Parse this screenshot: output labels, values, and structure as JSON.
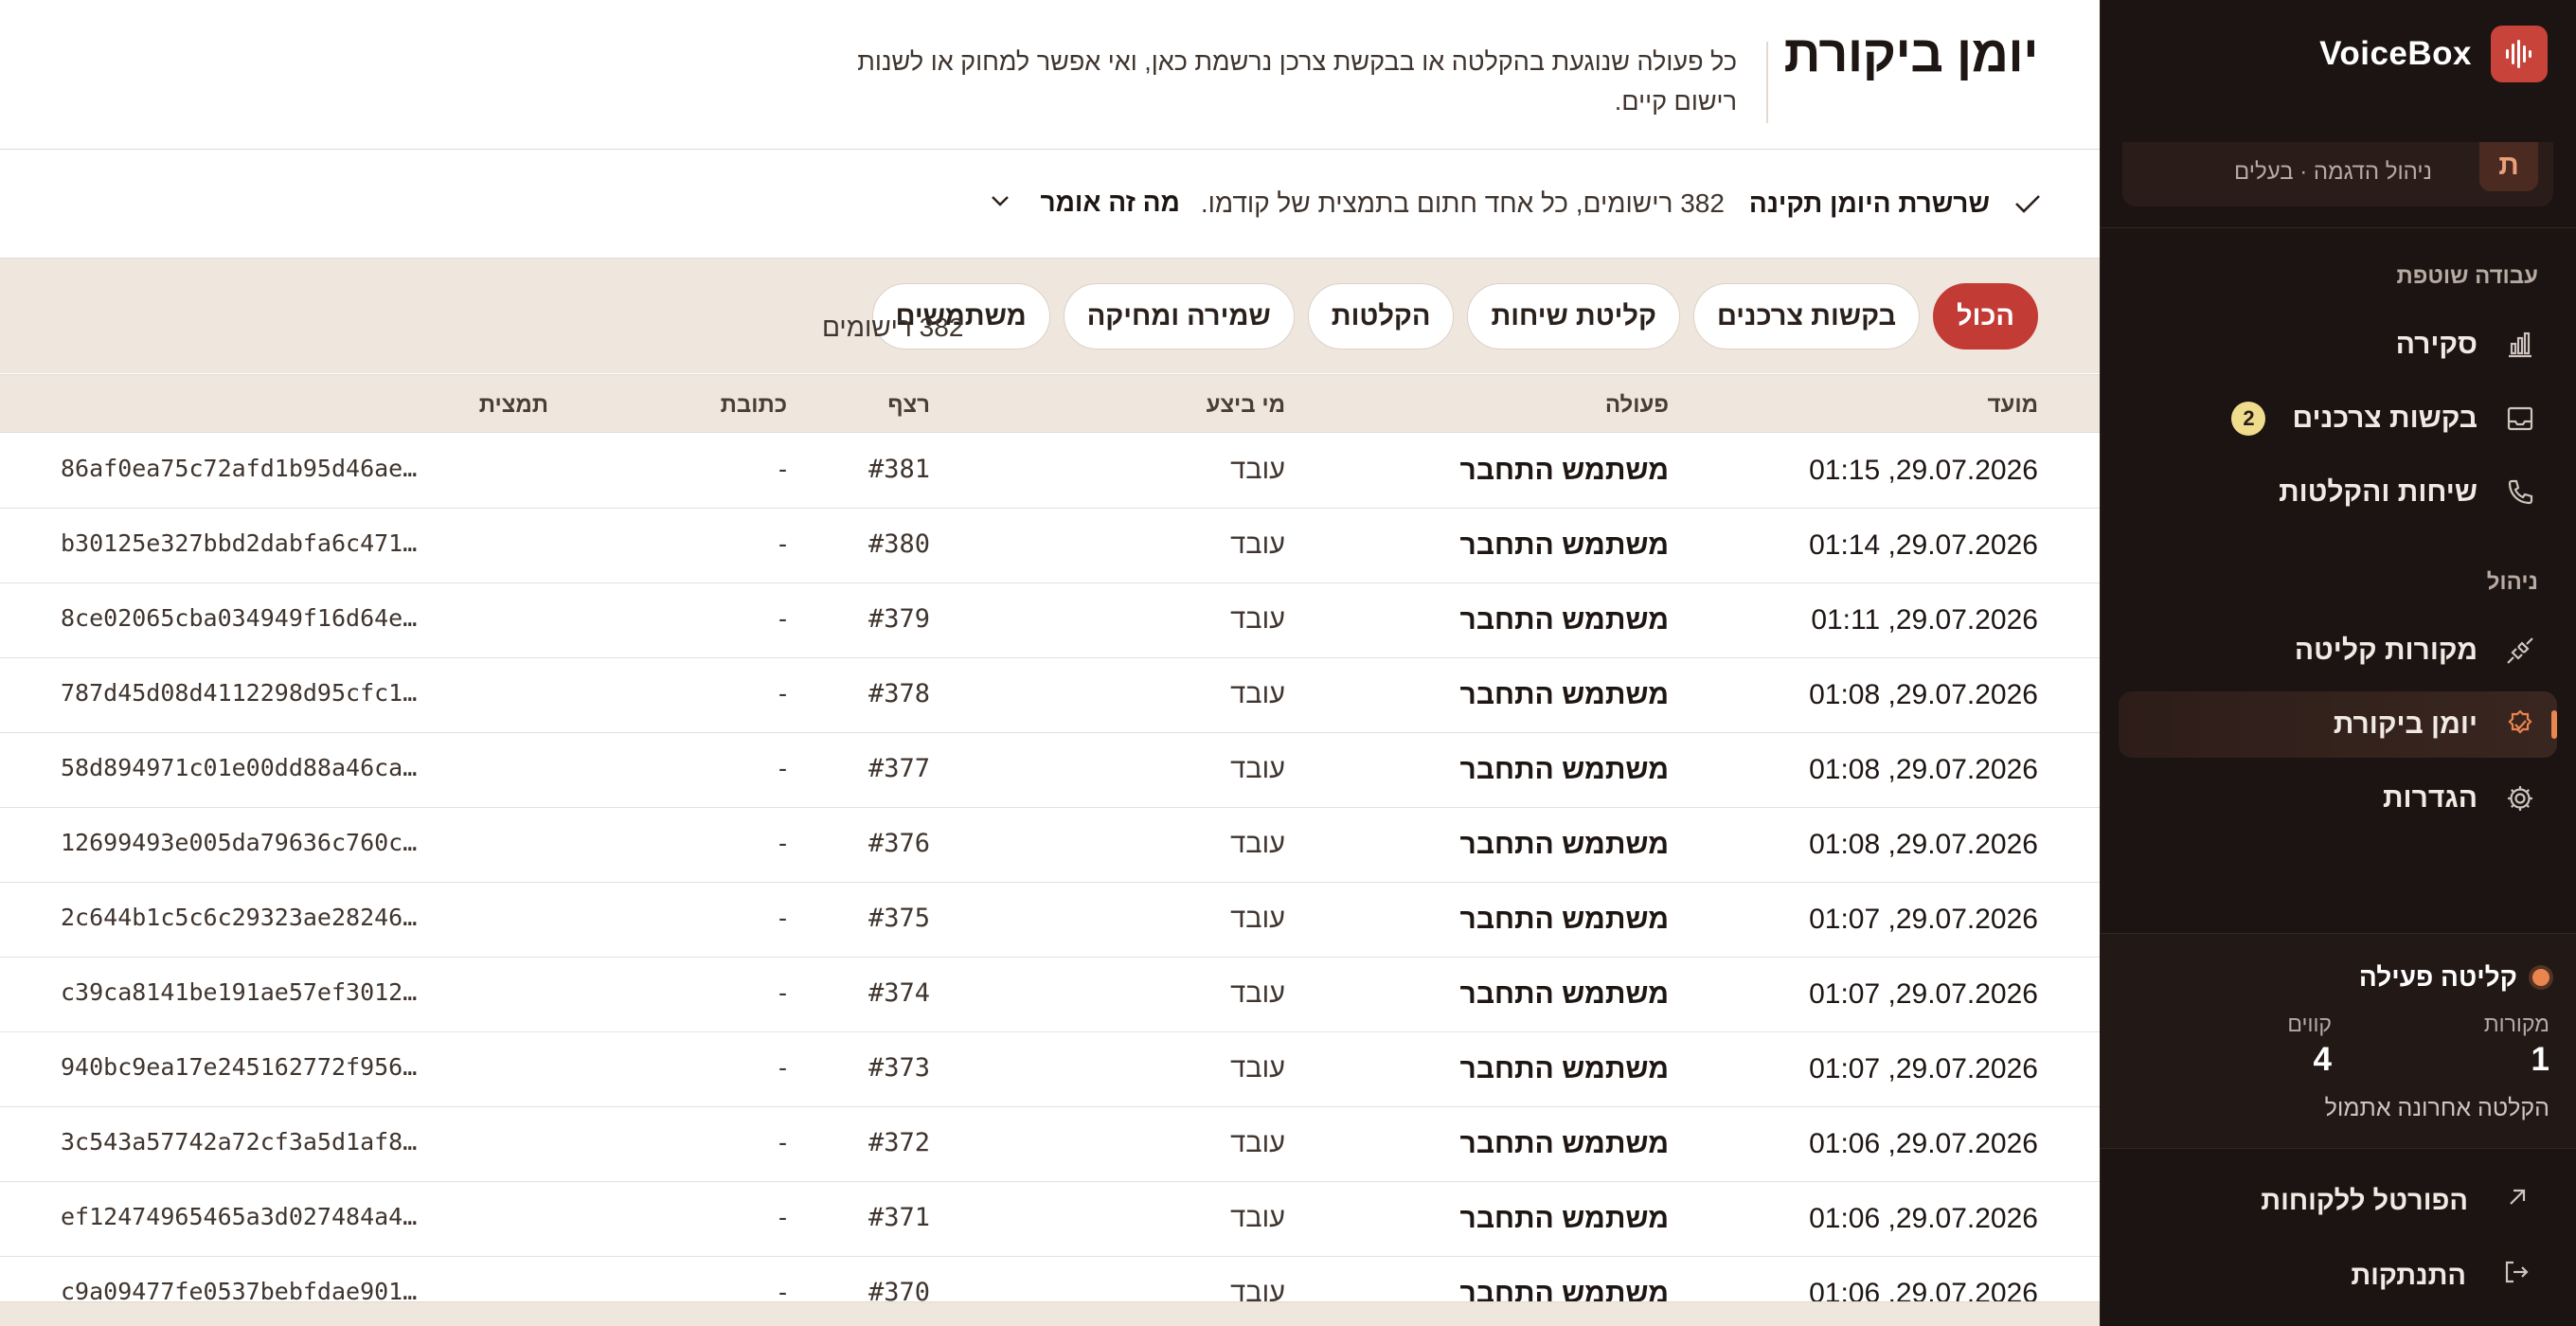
{
  "brand": {
    "name": "VoiceBox"
  },
  "org": {
    "avatar": "ת",
    "subtitle": "ניהול הדגמה · בעלים"
  },
  "sidebar": {
    "section_collab": "עבודה שוטפת",
    "section_manage": "ניהול",
    "items": [
      {
        "label": "סקירה",
        "icon": "bar-chart-icon"
      },
      {
        "label": "בקשות צרכנים",
        "icon": "inbox-icon",
        "badge": "2"
      },
      {
        "label": "שיחות והקלטות",
        "icon": "phone-icon"
      },
      {
        "label": "מקורות קליטה",
        "icon": "plug-icon"
      },
      {
        "label": "יומן ביקורת",
        "icon": "badge-check-icon",
        "active": true
      },
      {
        "label": "הגדרות",
        "icon": "gear-icon"
      }
    ],
    "ingest": {
      "title": "קליטה פעילה",
      "sources_label": "מקורות",
      "sources_value": "1",
      "lines_label": "קווים",
      "lines_value": "4",
      "last": "הקלטה אחרונה אתמול"
    },
    "footer": {
      "portal": "הפורטל ללקוחות",
      "logout": "התנתקות"
    }
  },
  "header": {
    "title": "יומן ביקורת",
    "description": "כל פעולה שנוגעת בהקלטה או בבקשת צרכן נרשמת כאן, ואי אפשר למחוק או לשנות רישום קיים."
  },
  "chain": {
    "title": "שרשרת היומן תקינה",
    "text": "382 רישומים, כל אחד חתום בתמצית של קודמו.",
    "more": "מה זה אומר"
  },
  "filters": {
    "chips": [
      "הכול",
      "בקשות צרכנים",
      "קליטת שיחות",
      "הקלטות",
      "שמירה ומחיקה",
      "משתמשים"
    ],
    "active_index": 0,
    "count": "382 רישומים"
  },
  "table": {
    "columns": {
      "date": "מועד",
      "action": "פעולה",
      "actor": "מי ביצע",
      "seq": "רצף",
      "address": "כתובת",
      "hash": "תמצית"
    },
    "rows": [
      {
        "date": "29.07.2026, 01:15",
        "action": "משתמש התחבר",
        "actor": "עובד",
        "seq": "#381",
        "address": "-",
        "hash": "86af0ea75c72afd1b95d46ae…"
      },
      {
        "date": "29.07.2026, 01:14",
        "action": "משתמש התחבר",
        "actor": "עובד",
        "seq": "#380",
        "address": "-",
        "hash": "b30125e327bbd2dabfa6c471…"
      },
      {
        "date": "29.07.2026, 01:11",
        "action": "משתמש התחבר",
        "actor": "עובד",
        "seq": "#379",
        "address": "-",
        "hash": "8ce02065cba034949f16d64e…"
      },
      {
        "date": "29.07.2026, 01:08",
        "action": "משתמש התחבר",
        "actor": "עובד",
        "seq": "#378",
        "address": "-",
        "hash": "787d45d08d4112298d95cfc1…"
      },
      {
        "date": "29.07.2026, 01:08",
        "action": "משתמש התחבר",
        "actor": "עובד",
        "seq": "#377",
        "address": "-",
        "hash": "58d894971c01e00dd88a46ca…"
      },
      {
        "date": "29.07.2026, 01:08",
        "action": "משתמש התחבר",
        "actor": "עובד",
        "seq": "#376",
        "address": "-",
        "hash": "12699493e005da79636c760c…"
      },
      {
        "date": "29.07.2026, 01:07",
        "action": "משתמש התחבר",
        "actor": "עובד",
        "seq": "#375",
        "address": "-",
        "hash": "2c644b1c5c6c29323ae28246…"
      },
      {
        "date": "29.07.2026, 01:07",
        "action": "משתמש התחבר",
        "actor": "עובד",
        "seq": "#374",
        "address": "-",
        "hash": "c39ca8141be191ae57ef3012…"
      },
      {
        "date": "29.07.2026, 01:07",
        "action": "משתמש התחבר",
        "actor": "עובד",
        "seq": "#373",
        "address": "-",
        "hash": "940bc9ea17e245162772f956…"
      },
      {
        "date": "29.07.2026, 01:06",
        "action": "משתמש התחבר",
        "actor": "עובד",
        "seq": "#372",
        "address": "-",
        "hash": "3c543a57742a72cf3a5d1af8…"
      },
      {
        "date": "29.07.2026, 01:06",
        "action": "משתמש התחבר",
        "actor": "עובד",
        "seq": "#371",
        "address": "-",
        "hash": "ef12474965465a3d027484a4…"
      },
      {
        "date": "29.07.2026, 01:06",
        "action": "משתמש התחבר",
        "actor": "עובד",
        "seq": "#370",
        "address": "-",
        "hash": "c9a09477fe0537bebfdae901…"
      }
    ]
  },
  "colors": {
    "sidebar_bg": "#1c1412",
    "accent_red": "#c33b35",
    "accent_orange": "#e9854f",
    "filter_bg": "#efe6de",
    "badge": "#f0dc8d"
  }
}
